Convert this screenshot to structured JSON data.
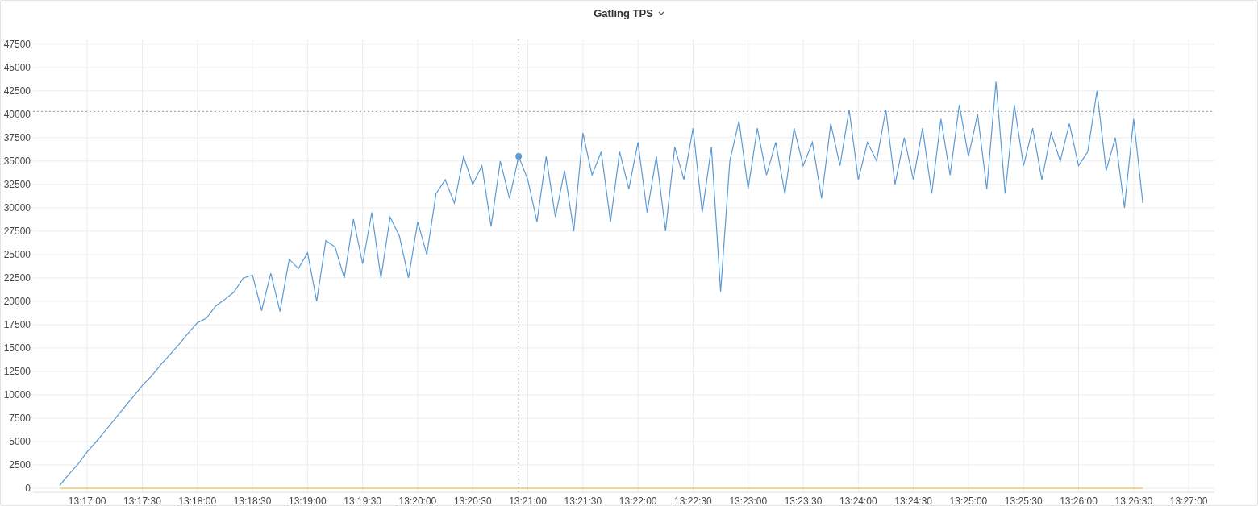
{
  "panel": {
    "title": "Gatling TPS",
    "chart_data": {
      "type": "line",
      "categories": [
        null,
        null,
        null,
        "13:17:00",
        null,
        null,
        null,
        null,
        null,
        "13:17:30",
        null,
        null,
        null,
        null,
        null,
        "13:18:00",
        null,
        null,
        null,
        null,
        null,
        "13:18:30",
        null,
        null,
        null,
        null,
        null,
        "13:19:00",
        null,
        null,
        null,
        null,
        null,
        "13:19:30",
        null,
        null,
        null,
        null,
        null,
        "13:20:00",
        null,
        null,
        null,
        null,
        null,
        "13:20:30",
        null,
        null,
        null,
        null,
        null,
        "13:21:00",
        null,
        null,
        null,
        null,
        null,
        "13:21:30",
        null,
        null,
        null,
        null,
        null,
        "13:22:00",
        null,
        null,
        null,
        null,
        null,
        "13:22:30",
        null,
        null,
        null,
        null,
        null,
        "13:23:00",
        null,
        null,
        null,
        null,
        null,
        "13:23:30",
        null,
        null,
        null,
        null,
        null,
        "13:24:00",
        null,
        null,
        null,
        null,
        null,
        "13:24:30",
        null,
        null,
        null,
        null,
        null,
        "13:25:00",
        null,
        null,
        null,
        null,
        null,
        "13:25:30",
        null,
        null,
        null,
        null,
        null,
        "13:26:00",
        null,
        null,
        null,
        null,
        null,
        "13:26:30",
        null,
        null,
        null,
        null,
        null,
        "13:27:00"
      ],
      "series": [
        {
          "color": "#5b9bd5",
          "values": [
            300,
            1500,
            2600,
            3900,
            5000,
            6200,
            7400,
            8600,
            9800,
            11000,
            12000,
            13200,
            14300,
            15400,
            16600,
            17700,
            18200,
            19500,
            20200,
            21000,
            22500,
            22800,
            19000,
            23000,
            18900,
            24500,
            23500,
            25200,
            20000,
            26500,
            25800,
            22500,
            28800,
            24000,
            29500,
            22500,
            29000,
            27000,
            22500,
            28500,
            25000,
            31500,
            33000,
            30500,
            35500,
            32500,
            34500,
            28000,
            35000,
            31000,
            35500,
            33000,
            28500,
            35500,
            29000,
            34000,
            27500,
            38000,
            33500,
            36000,
            28500,
            36000,
            32000,
            37000,
            29500,
            35500,
            27500,
            36500,
            33000,
            38500,
            29500,
            36500,
            21000,
            35000,
            39300,
            32000,
            38500,
            33500,
            37000,
            31500,
            38500,
            34500,
            37000,
            31000,
            39000,
            34500,
            40500,
            33000,
            37000,
            35000,
            40500,
            32500,
            37500,
            33000,
            38500,
            31500,
            39500,
            33500,
            41000,
            35500,
            40000,
            32000,
            43500,
            31500,
            41000,
            34500,
            38500,
            33000,
            38000,
            35000,
            39000,
            34500,
            36000,
            42500,
            34000,
            37500,
            30000,
            39500,
            30500,
            null,
            null,
            null,
            null,
            null
          ]
        },
        {
          "color": "#e5b82e",
          "values": [
            0,
            0,
            0,
            0,
            0,
            0,
            0,
            0,
            0,
            0,
            0,
            0,
            0,
            0,
            0,
            0,
            0,
            0,
            0,
            0,
            0,
            0,
            0,
            0,
            0,
            0,
            0,
            0,
            0,
            0,
            0,
            0,
            0,
            0,
            0,
            0,
            0,
            0,
            0,
            0,
            0,
            0,
            0,
            0,
            0,
            0,
            0,
            0,
            0,
            0,
            0,
            0,
            0,
            0,
            0,
            0,
            0,
            0,
            0,
            0,
            0,
            0,
            0,
            0,
            0,
            0,
            0,
            0,
            0,
            0,
            0,
            0,
            0,
            0,
            0,
            0,
            0,
            0,
            0,
            0,
            0,
            0,
            0,
            0,
            0,
            0,
            0,
            0,
            0,
            0,
            0,
            0,
            0,
            0,
            0,
            0,
            0,
            0,
            0,
            0,
            0,
            0,
            0,
            0,
            0,
            0,
            0,
            0,
            0,
            0,
            0,
            0,
            0,
            0,
            0,
            0,
            0,
            0,
            0,
            null,
            null,
            null,
            null,
            null
          ]
        }
      ],
      "ylim": [
        0,
        48000
      ],
      "yticks": [
        0,
        2500,
        5000,
        7500,
        10000,
        12500,
        15000,
        17500,
        20000,
        22500,
        25000,
        27500,
        30000,
        32500,
        35000,
        37500,
        40000,
        42500,
        45000,
        47500
      ],
      "grid": true,
      "ref_lines": [
        {
          "axis": "y",
          "value": 40300
        }
      ]
    }
  }
}
